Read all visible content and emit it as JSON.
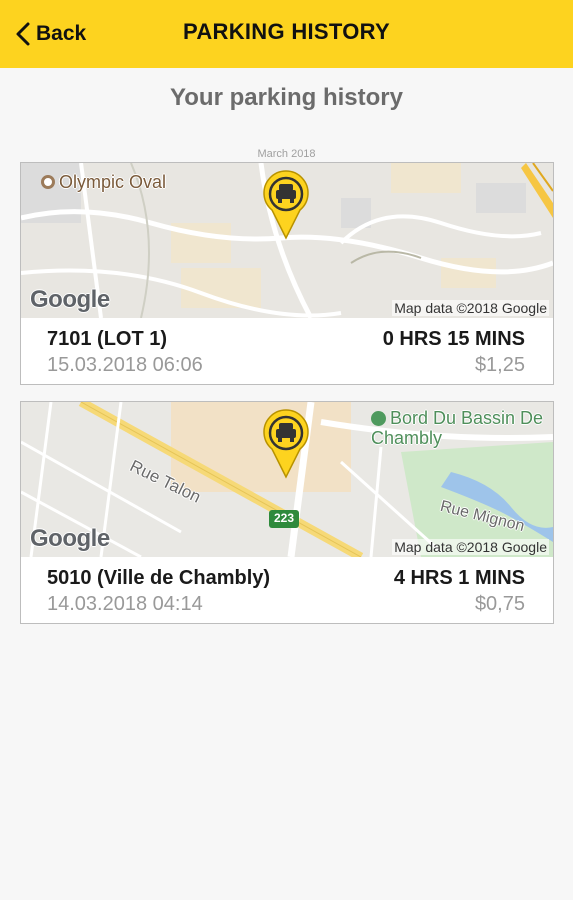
{
  "header": {
    "back_label": "Back",
    "title": "PARKING HISTORY",
    "bg_color": "#fdd31f"
  },
  "page": {
    "heading": "Your parking history",
    "month_label": "March 2018"
  },
  "records": [
    {
      "lot": "7101 (LOT 1)",
      "datetime": "15.03.2018 06:06",
      "duration": "0 HRS 15 MINS",
      "price": "$1,25",
      "map": {
        "provider_logo": "Google",
        "attribution": "Map data ©2018 Google",
        "poi_label": "Olympic Oval",
        "marker_icon": "car-parking-pin-icon"
      }
    },
    {
      "lot": "5010 (Ville de Chambly)",
      "datetime": "14.03.2018 04:14",
      "duration": "4 HRS 1 MINS",
      "price": "$0,75",
      "map": {
        "provider_logo": "Google",
        "attribution": "Map data ©2018 Google",
        "poi_label": "Bord Du Bassin De Chambly",
        "street_labels": [
          "Rue Talon",
          "Rue Mignon"
        ],
        "route_shield": "223",
        "marker_icon": "car-parking-pin-icon"
      }
    }
  ]
}
